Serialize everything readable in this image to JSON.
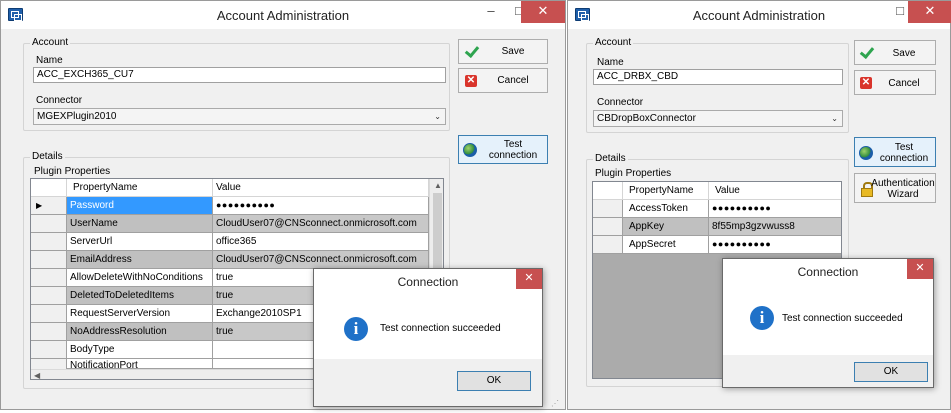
{
  "left_window": {
    "title": "Account Administration",
    "account_group": "Account",
    "name_label": "Name",
    "name_value": "ACC_EXCH365_CU7",
    "connector_label": "Connector",
    "connector_value": "MGEXPlugin2010",
    "details_group": "Details",
    "plugin_properties_label": "Plugin Properties",
    "buttons": {
      "save": "Save",
      "cancel": "Cancel",
      "test_line1": "Test",
      "test_line2": "connection"
    },
    "grid": {
      "col_name": "PropertyName",
      "col_value": "Value",
      "rows": [
        {
          "name": "Password",
          "value": "●●●●●●●●●●"
        },
        {
          "name": "UserName",
          "value": "CloudUser07@CNSconnect.onmicrosoft.com"
        },
        {
          "name": "ServerUrl",
          "value": "office365"
        },
        {
          "name": "EmailAddress",
          "value": "CloudUser07@CNSconnect.onmicrosoft.com"
        },
        {
          "name": "AllowDeleteWithNoConditions",
          "value": "true"
        },
        {
          "name": "DeletedToDeletedItems",
          "value": "true"
        },
        {
          "name": "RequestServerVersion",
          "value": "Exchange2010SP1"
        },
        {
          "name": "NoAddressResolution",
          "value": "true"
        },
        {
          "name": "BodyType",
          "value": ""
        },
        {
          "name": "NotificationPort",
          "value": ""
        }
      ]
    },
    "dialog": {
      "title": "Connection",
      "message": "Test connection succeeded",
      "ok": "OK"
    }
  },
  "right_window": {
    "title": "Account Administration",
    "account_group": "Account",
    "name_label": "Name",
    "name_value": "ACC_DRBX_CBD",
    "connector_label": "Connector",
    "connector_value": "CBDropBoxConnector",
    "details_group": "Details",
    "plugin_properties_label": "Plugin Properties",
    "buttons": {
      "save": "Save",
      "cancel": "Cancel",
      "test_line1": "Test",
      "test_line2": "connection",
      "auth_line1": "Authentication",
      "auth_line2": "Wizard"
    },
    "grid": {
      "col_name": "PropertyName",
      "col_value": "Value",
      "rows": [
        {
          "name": "AccessToken",
          "value": "●●●●●●●●●●"
        },
        {
          "name": "AppKey",
          "value": "8f55mp3gzvwuss8"
        },
        {
          "name": "AppSecret",
          "value": "●●●●●●●●●●"
        }
      ]
    },
    "dialog": {
      "title": "Connection",
      "message": "Test connection succeeded",
      "ok": "OK"
    }
  },
  "icons": {
    "app": "app-window-icon",
    "save": "checkmark-icon",
    "cancel": "x-icon",
    "test": "globe-icon",
    "auth": "lock-icon",
    "info": "info-icon"
  },
  "colors": {
    "selection": "#3399ff",
    "close": "#c75050",
    "info": "#1f71c8"
  }
}
